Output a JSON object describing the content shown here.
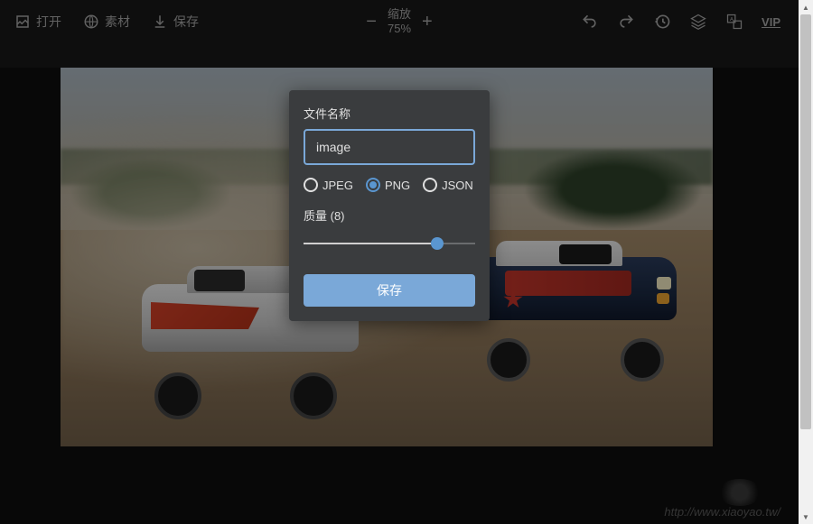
{
  "toolbar": {
    "open": "打开",
    "material": "素材",
    "save": "保存",
    "zoom_label": "缩放",
    "zoom_value": "75%",
    "vip": "VIP"
  },
  "dialog": {
    "filename_label": "文件名称",
    "filename_value": "image",
    "formats": {
      "jpeg": "JPEG",
      "png": "PNG",
      "json": "JSON",
      "selected": "png"
    },
    "quality_label": "质量 (8)",
    "quality_value": 8,
    "quality_max": 10,
    "save_button": "保存"
  },
  "watermark": "http://www.xiaoyao.tw/"
}
